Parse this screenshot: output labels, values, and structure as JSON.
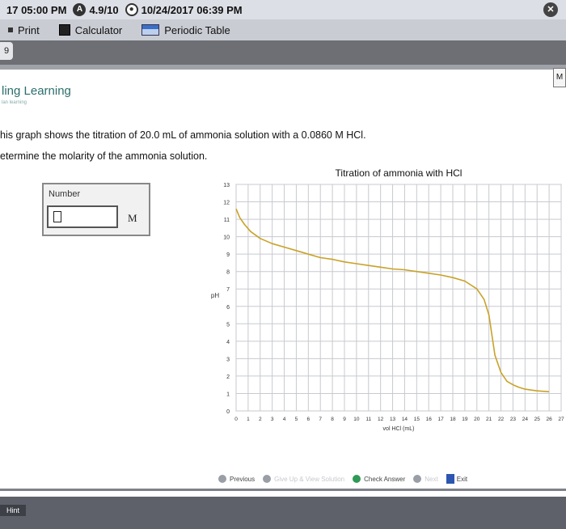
{
  "status_bar": {
    "time": "17 05:00 PM",
    "score_icon": "A",
    "score": "4.9/10",
    "due": "10/24/2017 06:39 PM"
  },
  "toolbar": {
    "print_label": "Print",
    "calculator_label": "Calculator",
    "periodic_table_label": "Periodic Table"
  },
  "page_tab": "9",
  "side_badge": "M",
  "brand": {
    "title": "ling Learning",
    "subtitle": "lan learning"
  },
  "question": {
    "line1": "his graph shows the titration of 20.0 mL of ammonia solution with a 0.0860 M HCl.",
    "line2": "etermine the molarity of the ammonia solution."
  },
  "answer": {
    "label": "Number",
    "value": "",
    "unit": "M"
  },
  "chart_data": {
    "type": "line",
    "title": "Titration of ammonia with HCl",
    "xlabel": "vol HCl (mL)",
    "ylabel": "pH",
    "xlim": [
      0,
      27
    ],
    "ylim": [
      0,
      13
    ],
    "x_ticks": [
      0,
      1,
      2,
      3,
      4,
      5,
      6,
      7,
      8,
      9,
      10,
      11,
      12,
      13,
      14,
      15,
      16,
      17,
      18,
      19,
      20,
      21,
      22,
      23,
      24,
      25,
      26,
      27
    ],
    "y_ticks": [
      0,
      1,
      2,
      3,
      4,
      5,
      6,
      7,
      8,
      9,
      10,
      11,
      12,
      13
    ],
    "grid": true,
    "line_color": "#c9a227",
    "series": [
      {
        "x": [
          0,
          0.3,
          0.7,
          1.2,
          2,
          3,
          4,
          5,
          6,
          7,
          8,
          9,
          10,
          11,
          12,
          13,
          14,
          15,
          16,
          17,
          18,
          19,
          20,
          20.6,
          21,
          21.5,
          22,
          22.5,
          23,
          23.5,
          24,
          24.5,
          25,
          26
        ],
        "y": [
          11.6,
          11.1,
          10.7,
          10.3,
          9.9,
          9.6,
          9.4,
          9.2,
          9.0,
          8.8,
          8.7,
          8.55,
          8.45,
          8.35,
          8.25,
          8.15,
          8.1,
          8.0,
          7.9,
          7.8,
          7.65,
          7.45,
          7.0,
          6.4,
          5.5,
          3.2,
          2.2,
          1.7,
          1.5,
          1.35,
          1.25,
          1.2,
          1.15,
          1.1
        ]
      }
    ]
  },
  "footer": {
    "previous_label": "Previous",
    "give_up_label": "Give Up & View Solution",
    "check_answer_label": "Check Answer",
    "next_label": "Next",
    "exit_label": "Exit",
    "hint_label": "Hint"
  }
}
